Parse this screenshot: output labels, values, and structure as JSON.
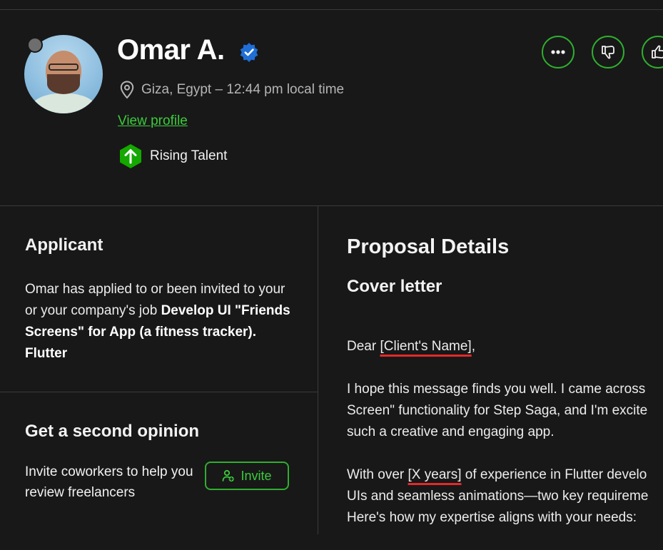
{
  "profile": {
    "name": "Omar A.",
    "location": "Giza, Egypt – 12:44 pm local time",
    "view_profile": "View profile",
    "badge": "Rising Talent"
  },
  "applicant": {
    "heading": "Applicant",
    "text_pre": "Omar has applied to or been invited to your or your company's job ",
    "job_title": "Develop UI \"Friends Screens\" for App (a fitness tracker). Flutter"
  },
  "second_opinion": {
    "heading": "Get a second opinion",
    "text": "Invite coworkers to help you review freelancers",
    "button": "Invite"
  },
  "proposal": {
    "heading": "Proposal Details",
    "cover_heading": "Cover letter",
    "greeting_pre": "Dear ",
    "greeting_placeholder": "[Client's Name]",
    "greeting_post": ",",
    "p1_line1": "I hope this message finds you well. I came across",
    "p1_line2": "Screen\" functionality for Step Saga, and I'm excite",
    "p1_line3": "such a creative and engaging app.",
    "p2_pre": "With over ",
    "p2_placeholder": "[X years]",
    "p2_post": " of experience in Flutter develo",
    "p2_line2": "UIs and seamless animations—two key requireme",
    "p2_line3": "Here's how my expertise aligns with your needs:"
  },
  "colors": {
    "accent": "#2fae2f",
    "accent_text": "#3ccb3c",
    "verified": "#1f6fd6",
    "background": "#181818"
  },
  "icons": [
    "more-icon",
    "thumbs-down-icon",
    "thumbs-up-icon",
    "location-pin-icon",
    "verified-icon",
    "rising-talent-icon",
    "add-person-icon"
  ]
}
